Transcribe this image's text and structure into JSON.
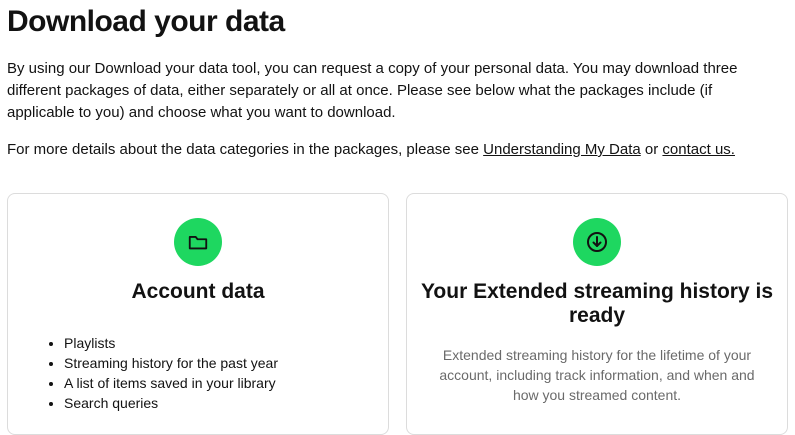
{
  "title": "Download your data",
  "intro": "By using our Download your data tool, you can request a copy of your personal data. You may download three different packages of data, either separately or all at once. Please see below what the packages include (if applicable to you) and choose what you want to download.",
  "details": {
    "prefix": "For more details about the data categories in the packages, please see ",
    "link1": "Understanding My Data",
    "middle": " or ",
    "link2": "contact us."
  },
  "colors": {
    "accent": "#1ed760",
    "text": "#121212",
    "muted": "#6a6a6a",
    "border": "#dcdcdc"
  },
  "cards": [
    {
      "icon": "folder-icon",
      "title": "Account data",
      "items": [
        "Playlists",
        "Streaming history for the past year",
        "A list of items saved in your library",
        "Search queries"
      ]
    },
    {
      "icon": "download-icon",
      "title": "Your Extended streaming history is ready",
      "description": "Extended streaming history for the lifetime of your account, including track information, and when and how you streamed content."
    }
  ]
}
